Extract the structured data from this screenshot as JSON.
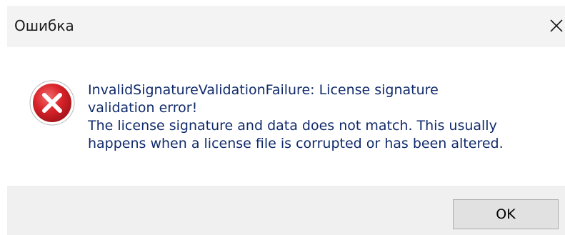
{
  "window": {
    "title": "Ошибка",
    "close_icon": "close-icon"
  },
  "message": {
    "icon": "error-icon",
    "lines": [
      "InvalidSignatureValidationFailure: License signature",
      "validation error!",
      "The license signature and data does not match. This usually",
      "happens when a license file is corrupted or has been altered."
    ]
  },
  "buttons": {
    "ok_label": "OK"
  },
  "colors": {
    "message_text": "#102a6b",
    "error_red": "#d9232a",
    "footer_bg": "#f0f0f0",
    "titlebar_bg": "#f3f3f3"
  }
}
